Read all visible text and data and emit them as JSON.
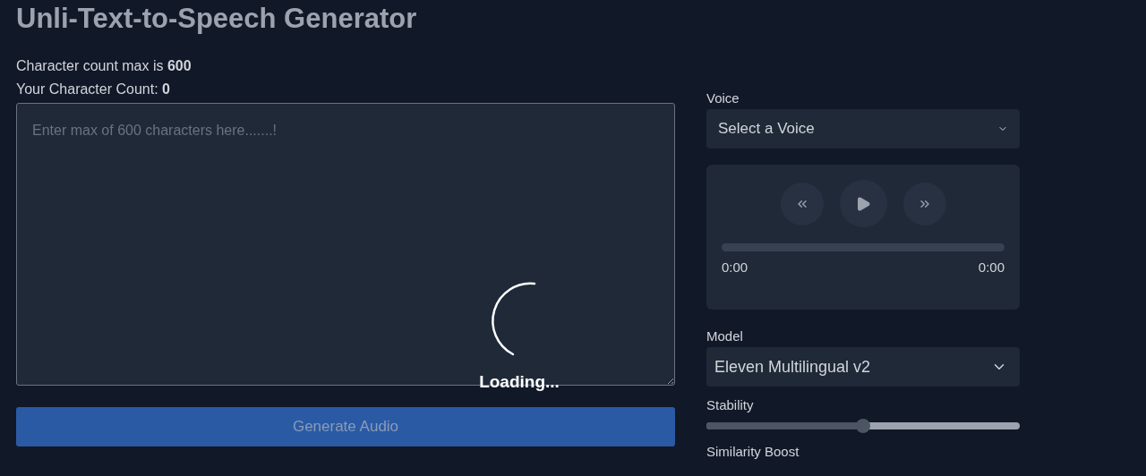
{
  "title": "Unli-Text-to-Speech Generator",
  "max_line": {
    "label": "Character count max is ",
    "value": "600"
  },
  "count_line": {
    "label": "Your Character Count: ",
    "value": "0"
  },
  "text_input": {
    "placeholder": "Enter max of 600 characters here.......!"
  },
  "loading": {
    "text": "Loading..."
  },
  "generate_button": {
    "label": "Generate Audio",
    "disabled": true
  },
  "voice": {
    "label": "Voice",
    "value": "Select a Voice"
  },
  "player": {
    "level": 0,
    "current_time": "0:00",
    "duration": "0:00"
  },
  "model": {
    "label": "Model",
    "value": "Eleven Multilingual v2"
  },
  "stability": {
    "label": "Stability",
    "level": 0.5
  },
  "similarity": {
    "label": "Similarity Boost"
  }
}
